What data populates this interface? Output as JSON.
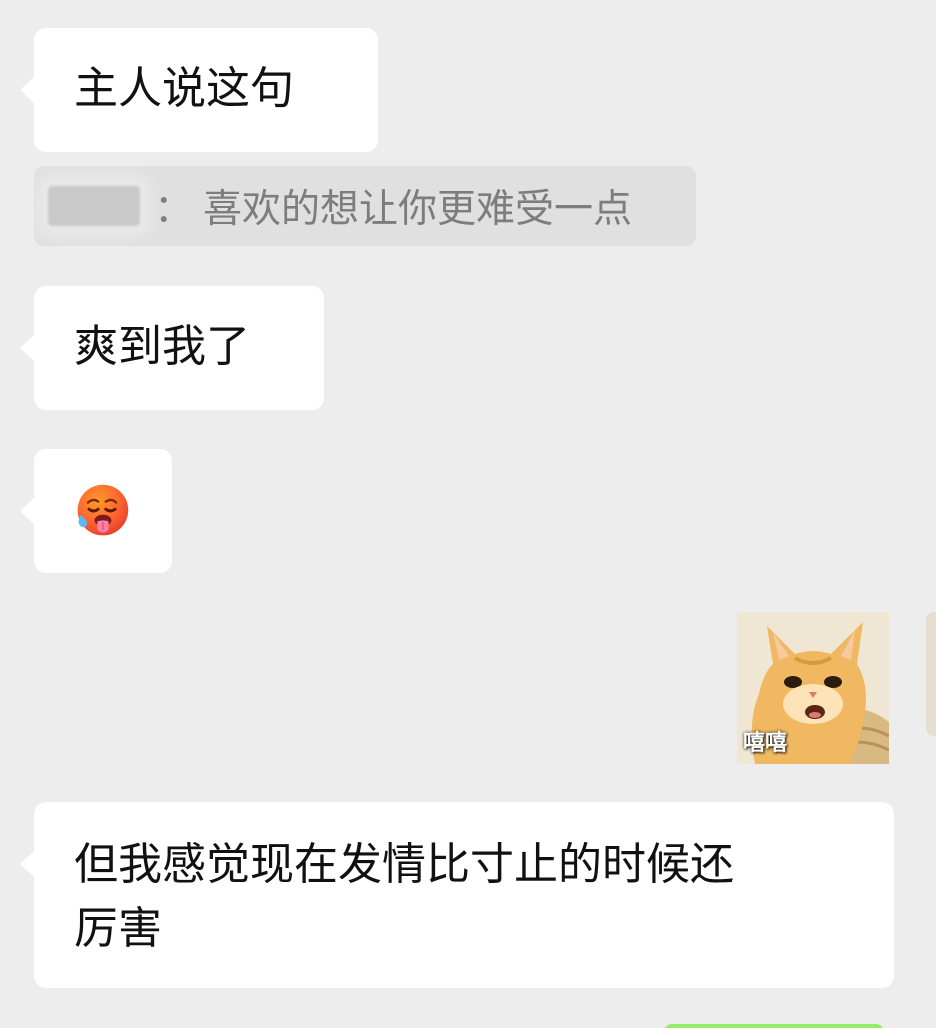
{
  "messages": [
    {
      "id": "m1",
      "type": "text",
      "side": "left",
      "text": "主人说这句"
    },
    {
      "id": "q1",
      "type": "quote",
      "sender_redacted": true,
      "colon": "：",
      "text": "喜欢的想让你更难受一点"
    },
    {
      "id": "m2",
      "type": "text",
      "side": "left",
      "text": "爽到我了"
    },
    {
      "id": "m3",
      "type": "emoji",
      "side": "left",
      "icon": "hot-face-emoji"
    },
    {
      "id": "m4",
      "type": "sticker",
      "side": "right",
      "icon": "cat-sticker",
      "caption": "嘻嘻"
    },
    {
      "id": "m5",
      "type": "text",
      "side": "left",
      "line1": "但我感觉现在发情比寸止的时候还",
      "line2": "厉害"
    }
  ],
  "colors": {
    "chat_background": "#ededed",
    "left_bubble": "#ffffff",
    "quote_background": "#e0e0e0",
    "quote_text": "#7d7d7d",
    "message_text": "#111111",
    "self_bubble": "#95ec69",
    "emoji_face": "#ff6b2f"
  }
}
